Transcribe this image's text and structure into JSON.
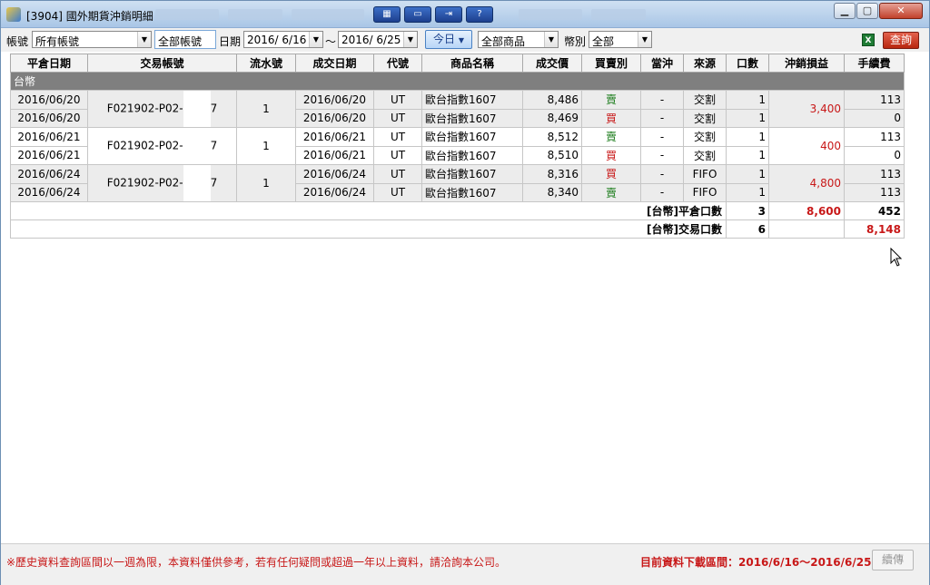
{
  "window": {
    "title": "[3904] 國外期貨沖銷明細"
  },
  "toolbar": {
    "account_label": "帳號",
    "account_select": "所有帳號",
    "account_box": "全部帳號",
    "date_label": "日期",
    "date_from": "2016/ 6/16",
    "date_sep": "～",
    "date_to": "2016/ 6/25",
    "today_button": "今日",
    "product_select": "全部商品",
    "currency_label": "幣別",
    "currency_select": "全部",
    "excel_icon": "excel-icon",
    "query_button": "查詢"
  },
  "table": {
    "headers": [
      "平倉日期",
      "交易帳號",
      "流水號",
      "成交日期",
      "代號",
      "商品名稱",
      "成交價",
      "買賣別",
      "當沖",
      "來源",
      "口數",
      "沖銷損益",
      "手續費"
    ],
    "group_label": "台幣",
    "rows": [
      {
        "close_date": "2016/06/20",
        "account": "F021902-P02-",
        "account_tail": "7",
        "serial": "1",
        "trade_date": "2016/06/20",
        "code": "UT",
        "name": "歐台指數1607",
        "price": "8,486",
        "side": "賣",
        "daytrade": "-",
        "source": "交割",
        "qty": "1",
        "pl": "3,400",
        "fee": "113"
      },
      {
        "close_date": "2016/06/20",
        "trade_date": "2016/06/20",
        "code": "UT",
        "name": "歐台指數1607",
        "price": "8,469",
        "side": "買",
        "daytrade": "-",
        "source": "交割",
        "qty": "1",
        "fee": "0"
      },
      {
        "close_date": "2016/06/21",
        "account": "F021902-P02-",
        "account_tail": "7",
        "serial": "1",
        "trade_date": "2016/06/21",
        "code": "UT",
        "name": "歐台指數1607",
        "price": "8,512",
        "side": "賣",
        "daytrade": "-",
        "source": "交割",
        "qty": "1",
        "pl": "400",
        "fee": "113"
      },
      {
        "close_date": "2016/06/21",
        "trade_date": "2016/06/21",
        "code": "UT",
        "name": "歐台指數1607",
        "price": "8,510",
        "side": "買",
        "daytrade": "-",
        "source": "交割",
        "qty": "1",
        "fee": "0"
      },
      {
        "close_date": "2016/06/24",
        "account": "F021902-P02-",
        "account_tail": "7",
        "serial": "1",
        "trade_date": "2016/06/24",
        "code": "UT",
        "name": "歐台指數1607",
        "price": "8,316",
        "side": "買",
        "daytrade": "-",
        "source": "FIFO",
        "qty": "1",
        "pl": "4,800",
        "fee": "113"
      },
      {
        "close_date": "2016/06/24",
        "trade_date": "2016/06/24",
        "code": "UT",
        "name": "歐台指數1607",
        "price": "8,340",
        "side": "賣",
        "daytrade": "-",
        "source": "FIFO",
        "qty": "1",
        "fee": "113"
      }
    ],
    "summary": [
      {
        "label": "[台幣]平倉口數",
        "qty": "3",
        "pl": "8,600",
        "fee": "452"
      },
      {
        "label": "[台幣]交易口數",
        "qty": "6",
        "pl": "",
        "fee": "8,148"
      }
    ]
  },
  "footer": {
    "note": "※歷史資料查詢區間以一週為限，本資料僅供參考，若有任何疑問或超過一年以上資料，請洽詢本公司。",
    "range": "目前資料下載區間：2016/6/16～2016/6/25",
    "more_button": "續傳"
  },
  "colors": {
    "sell": "#1c7d1c",
    "buy": "#c81818",
    "accent": "#c81818"
  }
}
